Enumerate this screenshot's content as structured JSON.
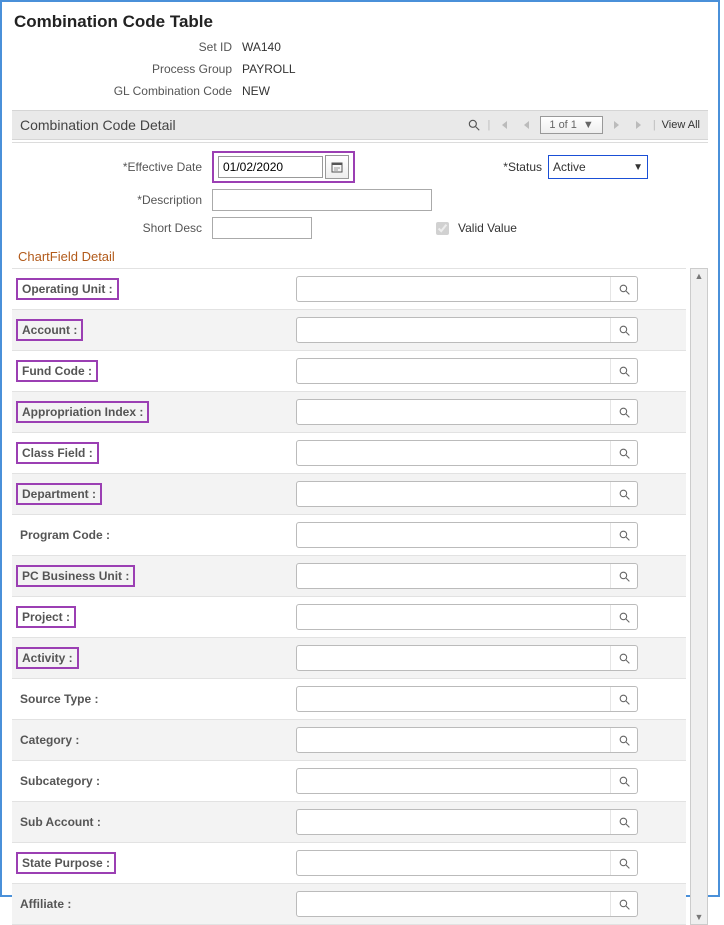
{
  "page_title": "Combination Code Table",
  "header": {
    "set_id_label": "Set ID",
    "set_id_value": "WA140",
    "process_group_label": "Process Group",
    "process_group_value": "PAYROLL",
    "gl_combo_label": "GL Combination Code",
    "gl_combo_value": "NEW"
  },
  "section": {
    "title": "Combination Code Detail",
    "pager_text": "1 of 1",
    "view_all_label": "View All"
  },
  "detail": {
    "effective_date_label": "*Effective Date",
    "effective_date_value": "01/02/2020",
    "status_label": "*Status",
    "status_value": "Active",
    "description_label": "*Description",
    "description_value": "",
    "short_desc_label": "Short Desc",
    "short_desc_value": "",
    "valid_value_label": "Valid Value",
    "valid_value_checked": true
  },
  "chartfield": {
    "title": "ChartField Detail",
    "fields": [
      {
        "label": "Operating Unit :",
        "highlight": true
      },
      {
        "label": "Account :",
        "highlight": true
      },
      {
        "label": "Fund Code :",
        "highlight": true
      },
      {
        "label": "Appropriation Index :",
        "highlight": true
      },
      {
        "label": "Class Field :",
        "highlight": true
      },
      {
        "label": "Department :",
        "highlight": true
      },
      {
        "label": "Program Code :",
        "highlight": false
      },
      {
        "label": "PC Business Unit :",
        "highlight": true
      },
      {
        "label": "Project :",
        "highlight": true
      },
      {
        "label": "Activity :",
        "highlight": true
      },
      {
        "label": "Source Type :",
        "highlight": false
      },
      {
        "label": "Category :",
        "highlight": false
      },
      {
        "label": "Subcategory :",
        "highlight": false
      },
      {
        "label": "Sub Account :",
        "highlight": false
      },
      {
        "label": "State Purpose :",
        "highlight": true
      },
      {
        "label": "Affiliate :",
        "highlight": false
      }
    ]
  }
}
